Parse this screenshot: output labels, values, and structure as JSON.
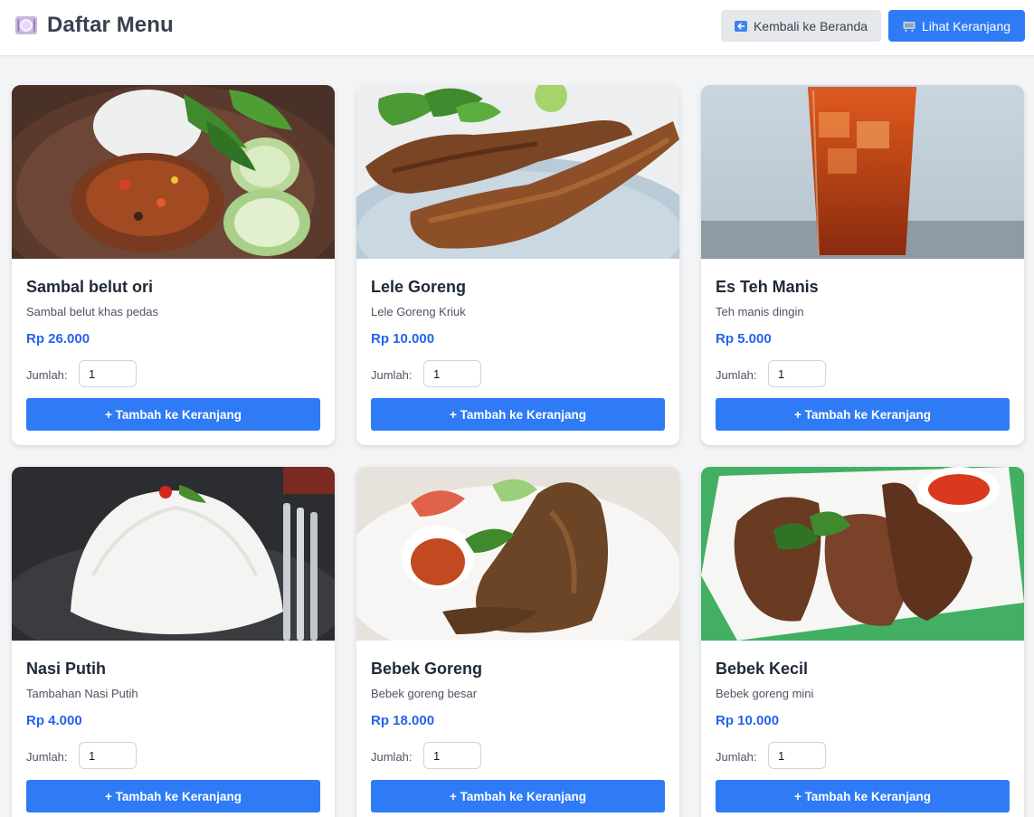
{
  "header": {
    "title": "Daftar Menu",
    "title_icon": "plate-icon",
    "home_button": {
      "label": "Kembali ke Beranda",
      "icon": "back-arrow-icon"
    },
    "cart_button": {
      "label": "Lihat Keranjang",
      "icon": "cart-icon"
    }
  },
  "common": {
    "qty_label": "Jumlah:",
    "add_button": "+ Tambah ke Keranjang"
  },
  "colors": {
    "accent": "#2f7bf5",
    "price": "#2563eb",
    "background": "#f3f4f6"
  },
  "menu": [
    {
      "name": "Sambal belut ori",
      "description": "Sambal belut khas pedas",
      "price": "Rp 26.000",
      "qty": "1",
      "image": "sambal-belut-photo"
    },
    {
      "name": "Lele Goreng",
      "description": "Lele Goreng Kriuk",
      "price": "Rp 10.000",
      "qty": "1",
      "image": "fried-catfish-photo"
    },
    {
      "name": "Es Teh Manis",
      "description": "Teh manis dingin",
      "price": "Rp 5.000",
      "qty": "1",
      "image": "iced-tea-photo"
    },
    {
      "name": "Nasi Putih",
      "description": "Tambahan Nasi Putih",
      "price": "Rp 4.000",
      "qty": "1",
      "image": "white-rice-photo"
    },
    {
      "name": "Bebek Goreng",
      "description": "Bebek goreng besar",
      "price": "Rp 18.000",
      "qty": "1",
      "image": "fried-duck-photo"
    },
    {
      "name": "Bebek Kecil",
      "description": "Bebek goreng mini",
      "price": "Rp 10.000",
      "qty": "1",
      "image": "small-fried-duck-photo"
    }
  ]
}
